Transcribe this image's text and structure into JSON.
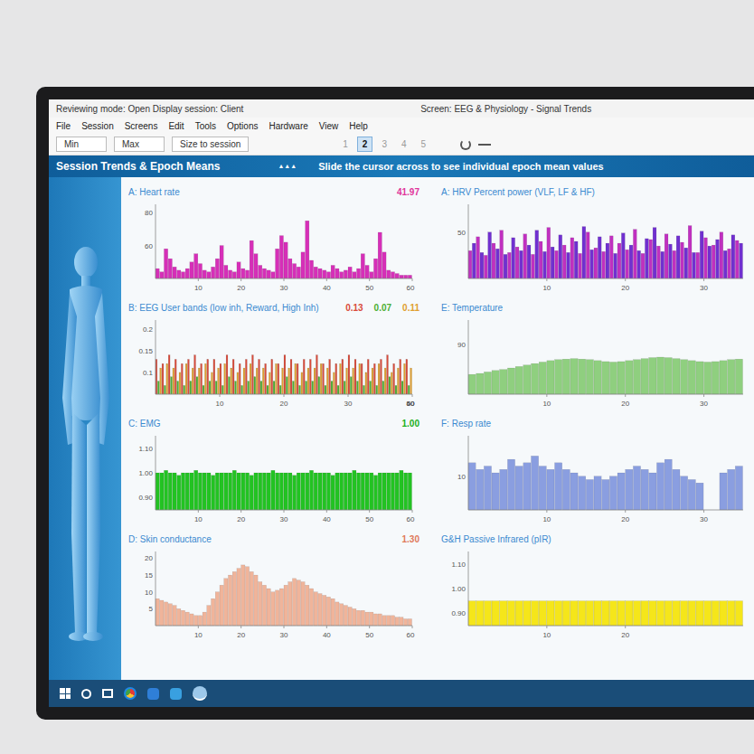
{
  "window": {
    "title": "Reviewing mode: Open Display session: Client",
    "screen_title": "Screen: EEG & Physiology - Signal Trends"
  },
  "menu": [
    "File",
    "Session",
    "Screens",
    "Edit",
    "Tools",
    "Options",
    "Hardware",
    "View",
    "Help"
  ],
  "toolbar": {
    "min_label": "Min",
    "max_label": "Max",
    "size_label": "Size to session",
    "pages": [
      {
        "label": "1",
        "selected": false
      },
      {
        "label": "2",
        "selected": true
      },
      {
        "label": "3",
        "selected": false
      },
      {
        "label": "4",
        "selected": false
      },
      {
        "label": "5",
        "selected": false
      }
    ]
  },
  "header": {
    "title": "Session Trends & Epoch Means",
    "marks": "▲▲▲",
    "instruction": "Slide the cursor across to see individual epoch mean values"
  },
  "left_charts": [
    {
      "title": "A: Heart rate",
      "readings": [
        {
          "text": "41.97",
          "color": "#e0359a"
        }
      ],
      "y_min": 40,
      "y_max": 85,
      "y_ticks": [
        "80",
        "60"
      ],
      "x_ticks": [
        "10",
        "20",
        "30",
        "40",
        "50",
        "60"
      ],
      "series": [
        {
          "color": "#d62fb8",
          "values": [
            46,
            44,
            58,
            52,
            47,
            45,
            44,
            46,
            50,
            55,
            49,
            45,
            44,
            47,
            52,
            60,
            48,
            45,
            44,
            50,
            46,
            45,
            63,
            55,
            48,
            46,
            45,
            44,
            58,
            66,
            62,
            52,
            49,
            47,
            56,
            75,
            51,
            47,
            46,
            45,
            44,
            48,
            46,
            44,
            45,
            47,
            44,
            46,
            55,
            48,
            44,
            52,
            68,
            56,
            45,
            44,
            43,
            42,
            42,
            42
          ]
        }
      ]
    },
    {
      "title": "B: EEG User bands (low inh, Reward, High Inh)",
      "readings": [
        {
          "text": "0.13",
          "color": "#d94a3a"
        },
        {
          "text": "0.07",
          "color": "#4caf32"
        },
        {
          "text": "0.11",
          "color": "#e0a030"
        }
      ],
      "y_min": 0.05,
      "y_max": 0.22,
      "y_ticks": [
        "0.2",
        "0.15",
        "0.1"
      ],
      "x_ticks": [
        "10",
        "20",
        "30",
        "40",
        "50",
        "60"
      ],
      "series": [
        {
          "color": "#d94a3a",
          "values": [
            0.13,
            0.12,
            0.14,
            0.13,
            0.12,
            0.13,
            0.14,
            0.12,
            0.13,
            0.13,
            0.12,
            0.14,
            0.13,
            0.12,
            0.13,
            0.14,
            0.13,
            0.12,
            0.13,
            0.12,
            0.14,
            0.13,
            0.12,
            0.13,
            0.13,
            0.14,
            0.12,
            0.13,
            0.12,
            0.13,
            0.14,
            0.13,
            0.12,
            0.13,
            0.12,
            0.13,
            0.14,
            0.12,
            0.13,
            0.13
          ]
        },
        {
          "color": "#4caf32",
          "values": [
            0.08,
            0.07,
            0.09,
            0.08,
            0.07,
            0.08,
            0.09,
            0.07,
            0.08,
            0.08,
            0.07,
            0.09,
            0.08,
            0.07,
            0.08,
            0.09,
            0.08,
            0.07,
            0.08,
            0.07,
            0.09,
            0.08,
            0.07,
            0.08,
            0.08,
            0.09,
            0.07,
            0.08,
            0.07,
            0.08,
            0.09,
            0.08,
            0.07,
            0.08,
            0.07,
            0.08,
            0.09,
            0.07,
            0.08,
            0.07
          ]
        },
        {
          "color": "#e0a030",
          "values": [
            0.11,
            0.12,
            0.11,
            0.1,
            0.12,
            0.11,
            0.11,
            0.12,
            0.1,
            0.11,
            0.12,
            0.11,
            0.1,
            0.11,
            0.12,
            0.11,
            0.11,
            0.1,
            0.12,
            0.11,
            0.11,
            0.12,
            0.1,
            0.11,
            0.11,
            0.12,
            0.11,
            0.1,
            0.12,
            0.11,
            0.11,
            0.12,
            0.1,
            0.11,
            0.12,
            0.11,
            0.1,
            0.11,
            0.12,
            0.11
          ]
        }
      ]
    },
    {
      "title": "C: EMG",
      "readings": [
        {
          "text": "1.00",
          "color": "#20b020"
        }
      ],
      "y_min": 0.85,
      "y_max": 1.15,
      "y_ticks": [
        "1.10",
        "1.00",
        "0.90"
      ],
      "x_ticks": [
        "10",
        "20",
        "30",
        "40",
        "50",
        "60"
      ],
      "series": [
        {
          "color": "#22c322",
          "values": [
            1.0,
            1.0,
            1.01,
            1.0,
            1.0,
            0.99,
            1.0,
            1.0,
            1.0,
            1.01,
            1.0,
            1.0,
            1.0,
            0.99,
            1.0,
            1.0,
            1.0,
            1.0,
            1.01,
            1.0,
            1.0,
            1.0,
            0.99,
            1.0,
            1.0,
            1.0,
            1.0,
            1.01,
            1.0,
            1.0,
            1.0,
            1.0,
            0.99,
            1.0,
            1.0,
            1.0,
            1.01,
            1.0,
            1.0,
            1.0,
            1.0,
            0.99,
            1.0,
            1.0,
            1.0,
            1.0,
            1.01,
            1.0,
            1.0,
            1.0,
            1.0,
            0.99,
            1.0,
            1.0,
            1.0,
            1.0,
            1.0,
            1.01,
            1.0,
            1.0
          ]
        }
      ]
    },
    {
      "title": "D: Skin conductance",
      "readings": [
        {
          "text": "1.30",
          "color": "#e07a5a"
        }
      ],
      "y_min": 0,
      "y_max": 22,
      "y_ticks": [
        "20",
        "15",
        "10",
        "5"
      ],
      "x_ticks": [
        "10",
        "20",
        "30",
        "40",
        "50",
        "60"
      ],
      "series": [
        {
          "color": "#f0b49a",
          "values": [
            8,
            7.5,
            7,
            6.5,
            6,
            5,
            4.5,
            4,
            3.5,
            3,
            3,
            4,
            6,
            8,
            10,
            12,
            14,
            15,
            16,
            17,
            18,
            17.5,
            16,
            15,
            13,
            12,
            11,
            10,
            10.5,
            11,
            12,
            13,
            14,
            13.5,
            13,
            12,
            11,
            10,
            9.5,
            9,
            8.5,
            8,
            7,
            6.5,
            6,
            5.5,
            5,
            4.5,
            4.5,
            4,
            4,
            3.5,
            3.5,
            3,
            3,
            3,
            2.5,
            2.5,
            2,
            2
          ]
        }
      ]
    }
  ],
  "right_charts": [
    {
      "title": "A: HRV Percent power (VLF, LF & HF)",
      "readings": [],
      "y_min": 0,
      "y_max": 80,
      "y_ticks": [
        "50"
      ],
      "x_ticks": [
        "10",
        "20",
        "30"
      ],
      "series": [
        {
          "color": "#c030c0",
          "values": [
            30,
            45,
            25,
            38,
            52,
            28,
            34,
            48,
            26,
            40,
            55,
            30,
            36,
            44,
            27,
            50,
            33,
            29,
            46,
            38,
            31,
            53,
            27,
            42,
            35,
            48,
            30,
            39,
            57,
            28,
            44,
            36,
            50,
            32,
            41
          ]
        },
        {
          "color": "#7030d0",
          "values": [
            38,
            28,
            50,
            32,
            26,
            44,
            30,
            36,
            52,
            29,
            34,
            47,
            28,
            40,
            56,
            31,
            45,
            38,
            27,
            49,
            36,
            30,
            43,
            55,
            29,
            37,
            46,
            33,
            28,
            51,
            35,
            42,
            30,
            47,
            38
          ]
        }
      ]
    },
    {
      "title": "E: Temperature",
      "readings": [],
      "y_min": 80,
      "y_max": 95,
      "y_ticks": [
        "90"
      ],
      "x_ticks": [
        "10",
        "20",
        "30"
      ],
      "series": [
        {
          "color": "#8fcf7f",
          "values": [
            84,
            84.2,
            84.5,
            84.8,
            85,
            85.3,
            85.6,
            85.9,
            86.2,
            86.5,
            86.8,
            87,
            87.1,
            87.2,
            87.1,
            87,
            86.8,
            86.6,
            86.5,
            86.6,
            86.8,
            87,
            87.2,
            87.4,
            87.5,
            87.4,
            87.2,
            87,
            86.8,
            86.6,
            86.5,
            86.6,
            86.8,
            87,
            87.1
          ]
        }
      ]
    },
    {
      "title": "F: Resp rate",
      "readings": [],
      "y_min": 0,
      "y_max": 22,
      "y_ticks": [
        "10"
      ],
      "x_ticks": [
        "10",
        "20",
        "30"
      ],
      "series": [
        {
          "color": "#8a9ee0",
          "values": [
            14,
            12,
            13,
            11,
            12,
            15,
            13,
            14,
            16,
            13,
            12,
            14,
            12,
            11,
            10,
            9,
            10,
            9,
            10,
            11,
            12,
            13,
            12,
            11,
            14,
            15,
            12,
            10,
            9,
            8,
            0,
            0,
            11,
            12,
            13
          ]
        }
      ]
    },
    {
      "title": "G&H Passive Infrared (pIR)",
      "readings": [],
      "y_min": 0.85,
      "y_max": 1.15,
      "y_ticks": [
        "1.10",
        "1.00",
        "0.90"
      ],
      "x_ticks": [
        "10",
        "20"
      ],
      "series": [
        {
          "color": "#f5e61a",
          "values": [
            0.95,
            0.95,
            0.95,
            0.95,
            0.95,
            0.95,
            0.95,
            0.95,
            0.95,
            0.95,
            0.95,
            0.95,
            0.95,
            0.95,
            0.95,
            0.95,
            0.95,
            0.95,
            0.95,
            0.95,
            0.95,
            0.95,
            0.95,
            0.95,
            0.95,
            0.95,
            0.95,
            0.95,
            0.95,
            0.95,
            0.95,
            0.95,
            0.95,
            0.95,
            0.95
          ]
        }
      ]
    }
  ]
}
